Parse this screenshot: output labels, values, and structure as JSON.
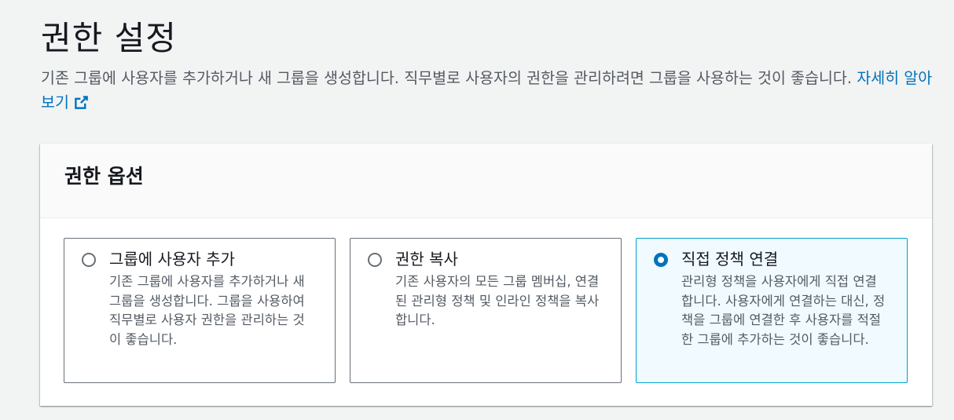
{
  "header": {
    "title": "권한 설정",
    "description": "기존 그룹에 사용자를 추가하거나 새 그룹을 생성합니다. 직무별로 사용자의 권한을 관리하려면 그룹을 사용하는 것이 좋습니다.",
    "learn_more": "자세히 알아보기",
    "learn_more_icon": "external-link-icon"
  },
  "options": {
    "title": "권한 옵션",
    "tiles": [
      {
        "label": "그룹에 사용자 추가",
        "description": "기존 그룹에 사용자를 추가하거나 새 그룹을 생성합니다. 그룹을 사용하여 직무별로 사용자 권한을 관리하는 것이 좋습니다.",
        "selected": false
      },
      {
        "label": "권한 복사",
        "description": "기존 사용자의 모든 그룹 멤버십, 연결된 관리형 정책 및 인라인 정책을 복사합니다.",
        "selected": false
      },
      {
        "label": "직접 정책 연결",
        "description": "관리형 정책을 사용자에게 직접 연결합니다. 사용자에게 연결하는 대신, 정책을 그룹에 연결한 후 사용자를 적절한 그룹에 추가하는 것이 좋습니다.",
        "selected": true
      }
    ]
  },
  "colors": {
    "link": "#0073bb",
    "selected_border": "#00a1c9",
    "selected_background": "#f1faff"
  }
}
